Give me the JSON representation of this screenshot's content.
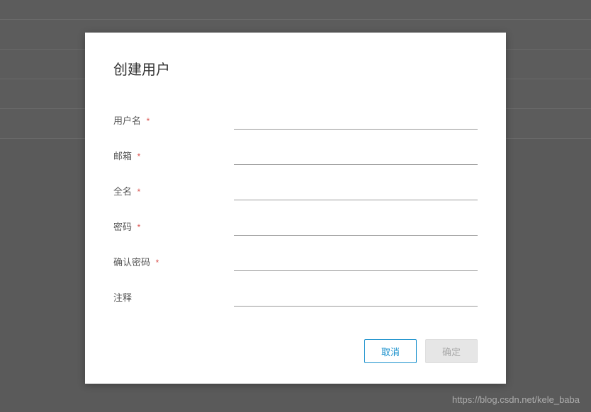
{
  "modal": {
    "title": "创建用户",
    "fields": [
      {
        "label": "用户名",
        "required": true,
        "value": ""
      },
      {
        "label": "邮箱",
        "required": true,
        "value": ""
      },
      {
        "label": "全名",
        "required": true,
        "value": ""
      },
      {
        "label": "密码",
        "required": true,
        "value": ""
      },
      {
        "label": "确认密码",
        "required": true,
        "value": ""
      },
      {
        "label": "注释",
        "required": false,
        "value": ""
      }
    ],
    "required_marker": "*",
    "buttons": {
      "cancel": "取消",
      "confirm": "确定"
    }
  },
  "watermark": "https://blog.csdn.net/kele_baba"
}
